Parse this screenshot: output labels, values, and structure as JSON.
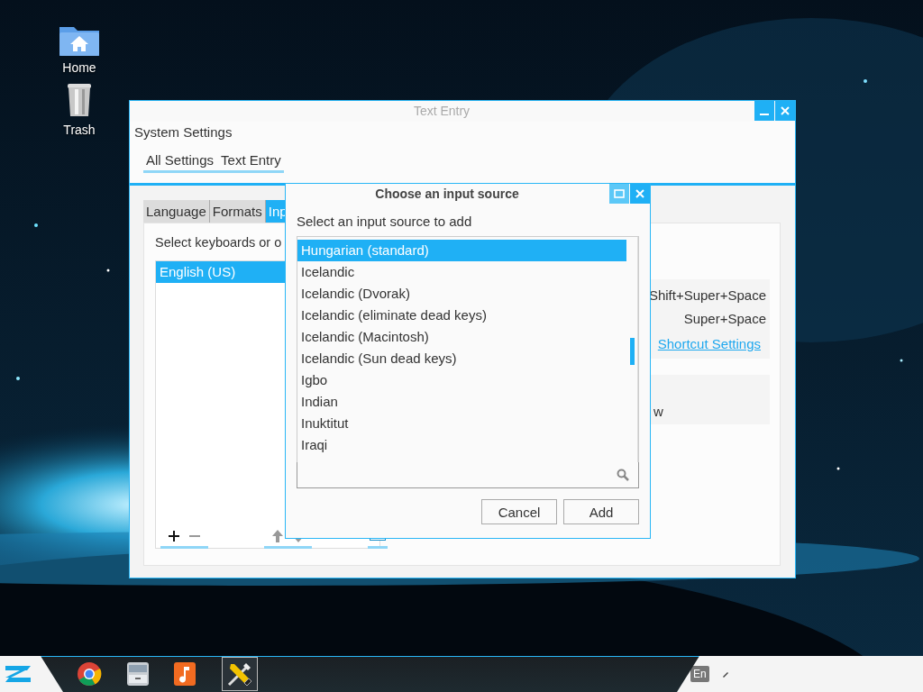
{
  "desktop": {
    "icons": [
      {
        "label": "Home",
        "kind": "folder"
      },
      {
        "label": "Trash",
        "kind": "trash"
      }
    ]
  },
  "main_window": {
    "title": "Text Entry",
    "active": false,
    "header": "System Settings",
    "breadcrumbs": [
      "All Settings",
      "Text Entry"
    ],
    "notebook_tabs": [
      {
        "label": "Language",
        "selected": false
      },
      {
        "label": "Formats",
        "selected": false
      },
      {
        "label": "Inp",
        "selected": true
      }
    ],
    "instruction": "Select keyboards or o",
    "sources": [
      {
        "label": "English (US)",
        "selected": true
      }
    ],
    "shortcuts": [
      "Shift+Super+Space",
      "Super+Space"
    ],
    "shortcut_link": "Shortcut Settings",
    "partial_text": "w"
  },
  "dialog": {
    "title": "Choose an input source",
    "prompt": "Select an input source to add",
    "items": [
      {
        "label": "Hungarian (standard)",
        "selected": true
      },
      {
        "label": "Icelandic",
        "selected": false
      },
      {
        "label": "Icelandic (Dvorak)",
        "selected": false
      },
      {
        "label": "Icelandic (eliminate dead keys)",
        "selected": false
      },
      {
        "label": "Icelandic (Macintosh)",
        "selected": false
      },
      {
        "label": "Icelandic (Sun dead keys)",
        "selected": false
      },
      {
        "label": "Igbo",
        "selected": false
      },
      {
        "label": "Indian",
        "selected": false
      },
      {
        "label": "Inuktitut",
        "selected": false
      },
      {
        "label": "Iraqi",
        "selected": false
      }
    ],
    "buttons": [
      "Cancel",
      "Add"
    ]
  },
  "taskbar": {
    "apps": [
      {
        "kind": "browser",
        "active": false
      },
      {
        "kind": "cabinet",
        "active": false
      },
      {
        "kind": "music",
        "active": false
      },
      {
        "kind": "tools",
        "active": true
      }
    ],
    "keyboard_layout": "En"
  }
}
